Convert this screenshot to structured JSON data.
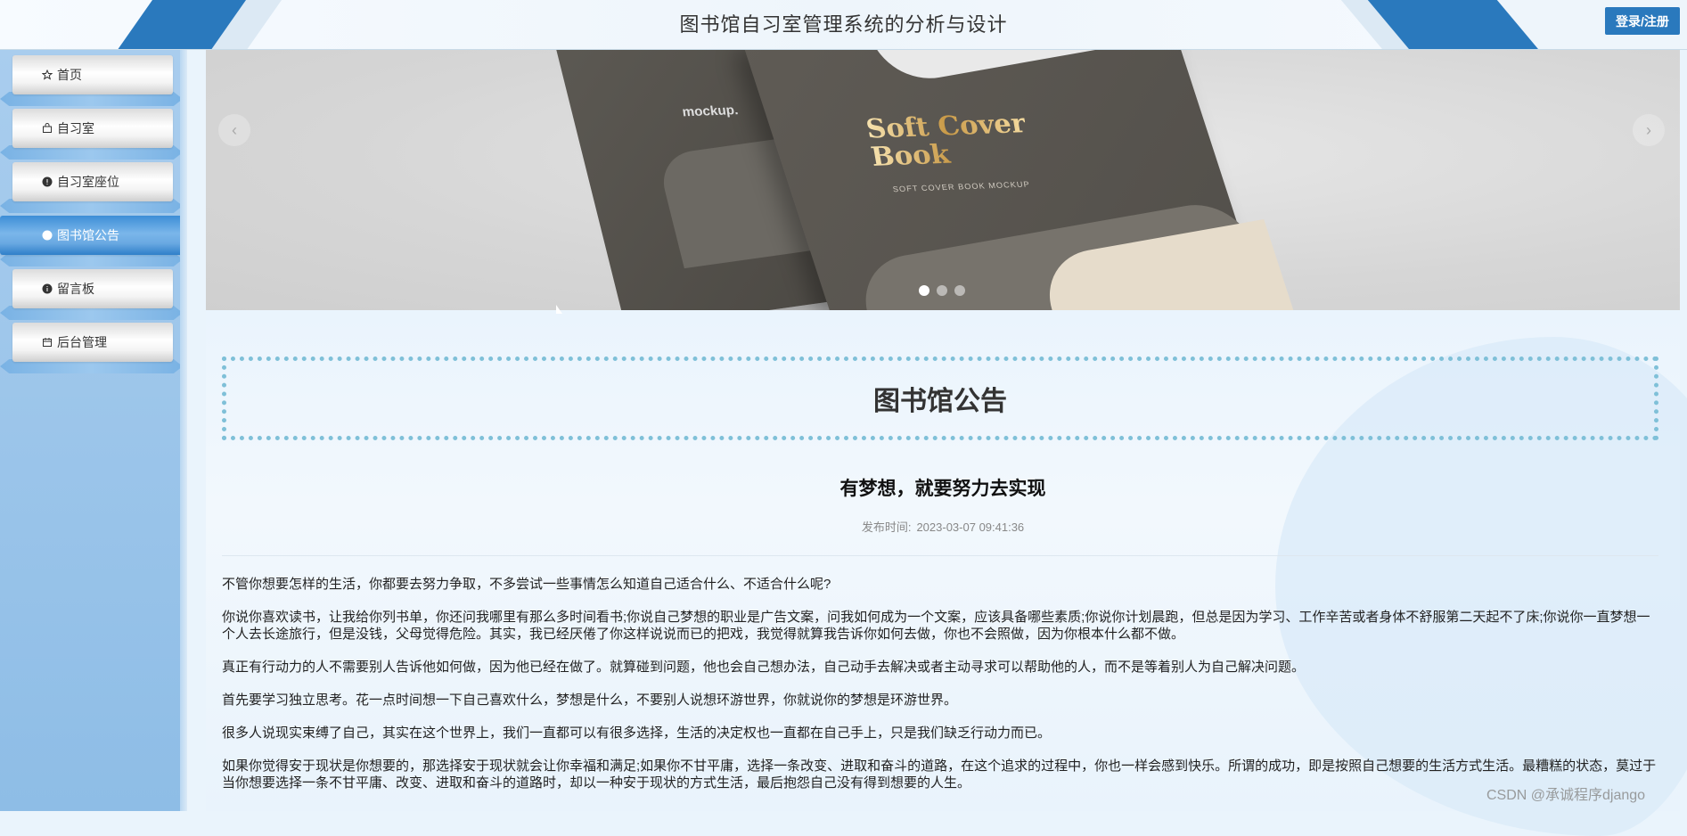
{
  "header": {
    "title": "图书馆自习室管理系统的分析与设计",
    "login_label": "登录/注册",
    "accent_color": "#2a79bd"
  },
  "sidebar": {
    "items": [
      {
        "label": "首页",
        "icon": "star-icon",
        "active": false
      },
      {
        "label": "自习室",
        "icon": "bag-icon",
        "active": false
      },
      {
        "label": "自习室座位",
        "icon": "alert-circle-icon",
        "active": false
      },
      {
        "label": "图书馆公告",
        "icon": "circle-icon",
        "active": true
      },
      {
        "label": "留言板",
        "icon": "info-circle-icon",
        "active": false
      },
      {
        "label": "后台管理",
        "icon": "calendar-icon",
        "active": false
      }
    ]
  },
  "carousel": {
    "prev_icon": "chevron-left-icon",
    "next_icon": "chevron-right-icon",
    "slide_count": 3,
    "active_index": 0,
    "book_title_line1": "Soft Cover",
    "book_title_line2": "Book",
    "book_subtitle": "SOFT COVER BOOK MOCKUP",
    "back_label": "mockup."
  },
  "section": {
    "title": "图书馆公告"
  },
  "article": {
    "title": "有梦想，就要努力去实现",
    "published_label": "发布时间:",
    "published_time": "2023-03-07 09:41:36",
    "paragraphs": [
      "不管你想要怎样的生活，你都要去努力争取，不多尝试一些事情怎么知道自己适合什么、不适合什么呢?",
      "你说你喜欢读书，让我给你列书单，你还问我哪里有那么多时间看书;你说自己梦想的职业是广告文案，问我如何成为一个文案，应该具备哪些素质;你说你计划晨跑，但总是因为学习、工作辛苦或者身体不舒服第二天起不了床;你说你一直梦想一个人去长途旅行，但是没钱，父母觉得危险。其实，我已经厌倦了你这样说说而已的把戏，我觉得就算我告诉你如何去做，你也不会照做，因为你根本什么都不做。",
      "真正有行动力的人不需要别人告诉他如何做，因为他已经在做了。就算碰到问题，他也会自己想办法，自己动手去解决或者主动寻求可以帮助他的人，而不是等着别人为自己解决问题。",
      "首先要学习独立思考。花一点时间想一下自己喜欢什么，梦想是什么，不要别人说想环游世界，你就说你的梦想是环游世界。",
      "很多人说现实束缚了自己，其实在这个世界上，我们一直都可以有很多选择，生活的决定权也一直都在自己手上，只是我们缺乏行动力而已。",
      "如果你觉得安于现状是你想要的，那选择安于现状就会让你幸福和满足;如果你不甘平庸，选择一条改变、进取和奋斗的道路，在这个追求的过程中，你也一样会感到快乐。所谓的成功，即是按照自己想要的生活方式生活。最糟糕的状态，莫过于当你想要选择一条不甘平庸、改变、进取和奋斗的道路时，却以一种安于现状的方式生活，最后抱怨自己没有得到想要的人生。"
    ]
  },
  "watermark": "CSDN @承诚程序django"
}
